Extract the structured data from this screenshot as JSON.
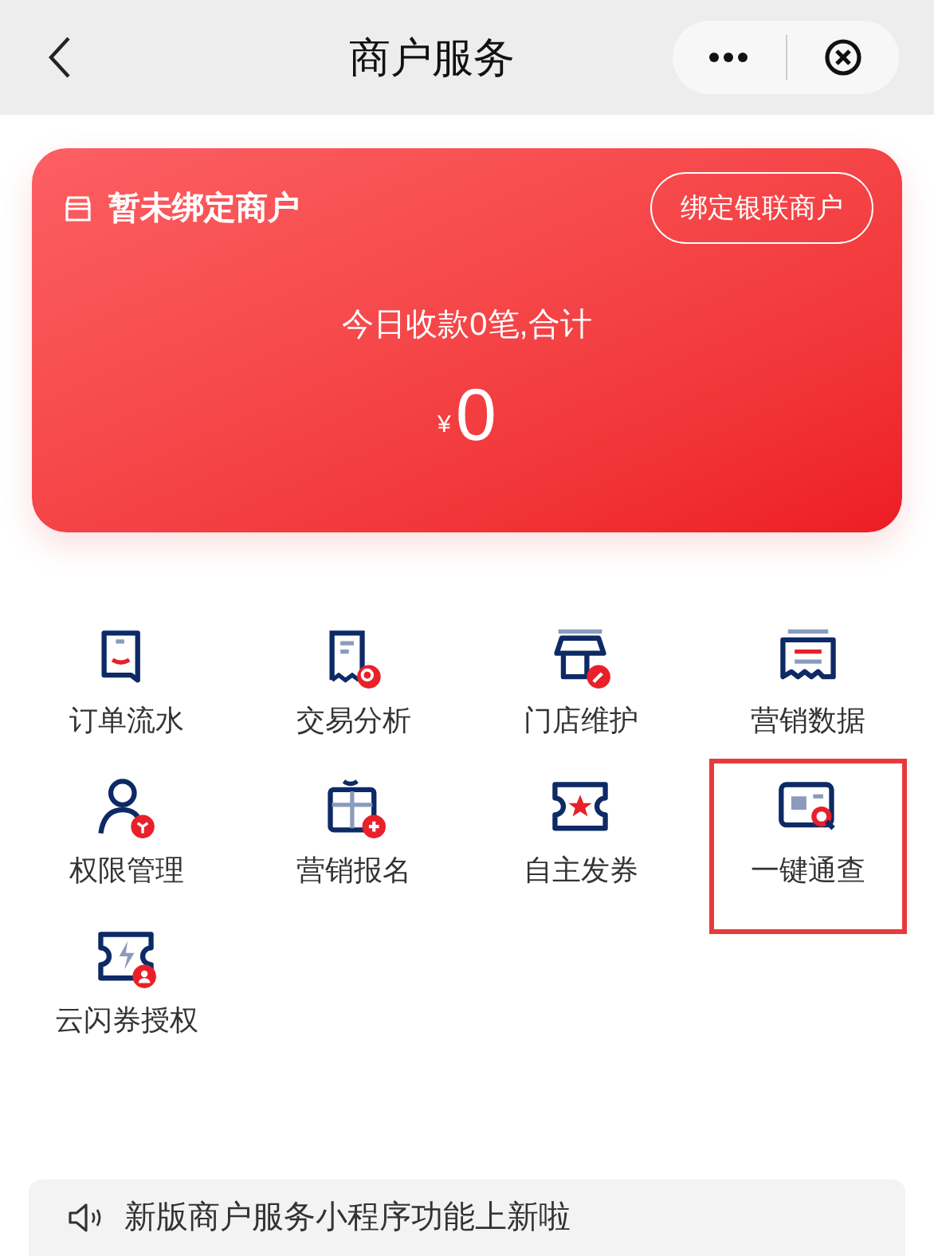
{
  "nav": {
    "title": "商户服务"
  },
  "card": {
    "title": "暂未绑定商户",
    "button": "绑定银联商户",
    "summary": "今日收款0笔,合计",
    "currency": "¥",
    "amount": "0"
  },
  "services": [
    {
      "kind": "order",
      "label": "订单流水",
      "highlighted": false
    },
    {
      "kind": "analysis",
      "label": "交易分析",
      "highlighted": false
    },
    {
      "kind": "store",
      "label": "门店维护",
      "highlighted": false
    },
    {
      "kind": "marketing-data",
      "label": "营销数据",
      "highlighted": false
    },
    {
      "kind": "permission",
      "label": "权限管理",
      "highlighted": false
    },
    {
      "kind": "signup",
      "label": "营销报名",
      "highlighted": false
    },
    {
      "kind": "coupon",
      "label": "自主发券",
      "highlighted": false
    },
    {
      "kind": "lookup",
      "label": "一键通查",
      "highlighted": true
    },
    {
      "kind": "authorize",
      "label": "云闪券授权",
      "highlighted": false
    }
  ],
  "notice": {
    "text": "新版商户服务小程序功能上新啦"
  }
}
